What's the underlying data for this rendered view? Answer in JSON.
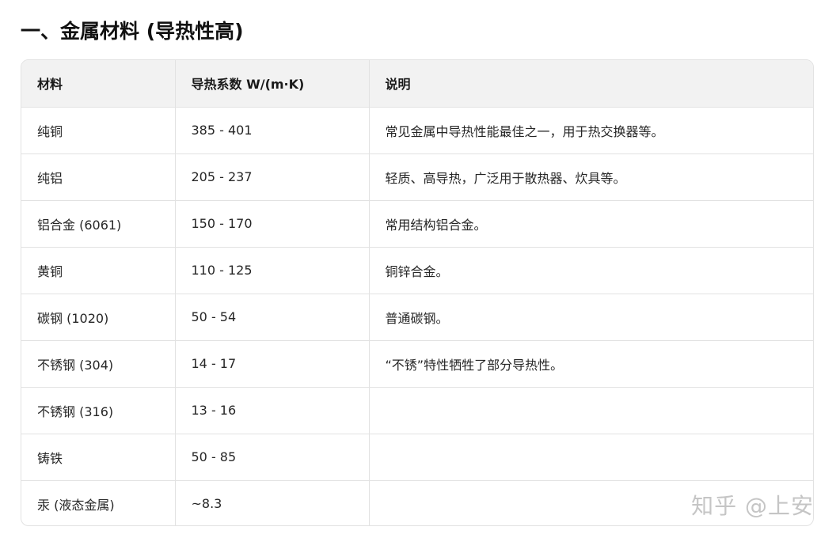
{
  "heading": "一、金属材料 (导热性高)",
  "table": {
    "headers": [
      "材料",
      "导热系数 W/(m·K)",
      "说明"
    ],
    "rows": [
      [
        "纯铜",
        "385 - 401",
        "常见金属中导热性能最佳之一，用于热交换器等。"
      ],
      [
        "纯铝",
        "205 - 237",
        "轻质、高导热，广泛用于散热器、炊具等。"
      ],
      [
        "铝合金 (6061)",
        "150 - 170",
        "常用结构铝合金。"
      ],
      [
        "黄铜",
        "110 - 125",
        "铜锌合金。"
      ],
      [
        "碳钢 (1020)",
        "50 - 54",
        "普通碳钢。"
      ],
      [
        "不锈钢 (304)",
        "14 - 17",
        "“不锈”特性牺牲了部分导热性。"
      ],
      [
        "不锈钢 (316)",
        "13 - 16",
        ""
      ],
      [
        "铸铁",
        "50 - 85",
        ""
      ],
      [
        "汞 (液态金属)",
        "~8.3",
        ""
      ]
    ]
  },
  "watermark": "知乎 @上安"
}
